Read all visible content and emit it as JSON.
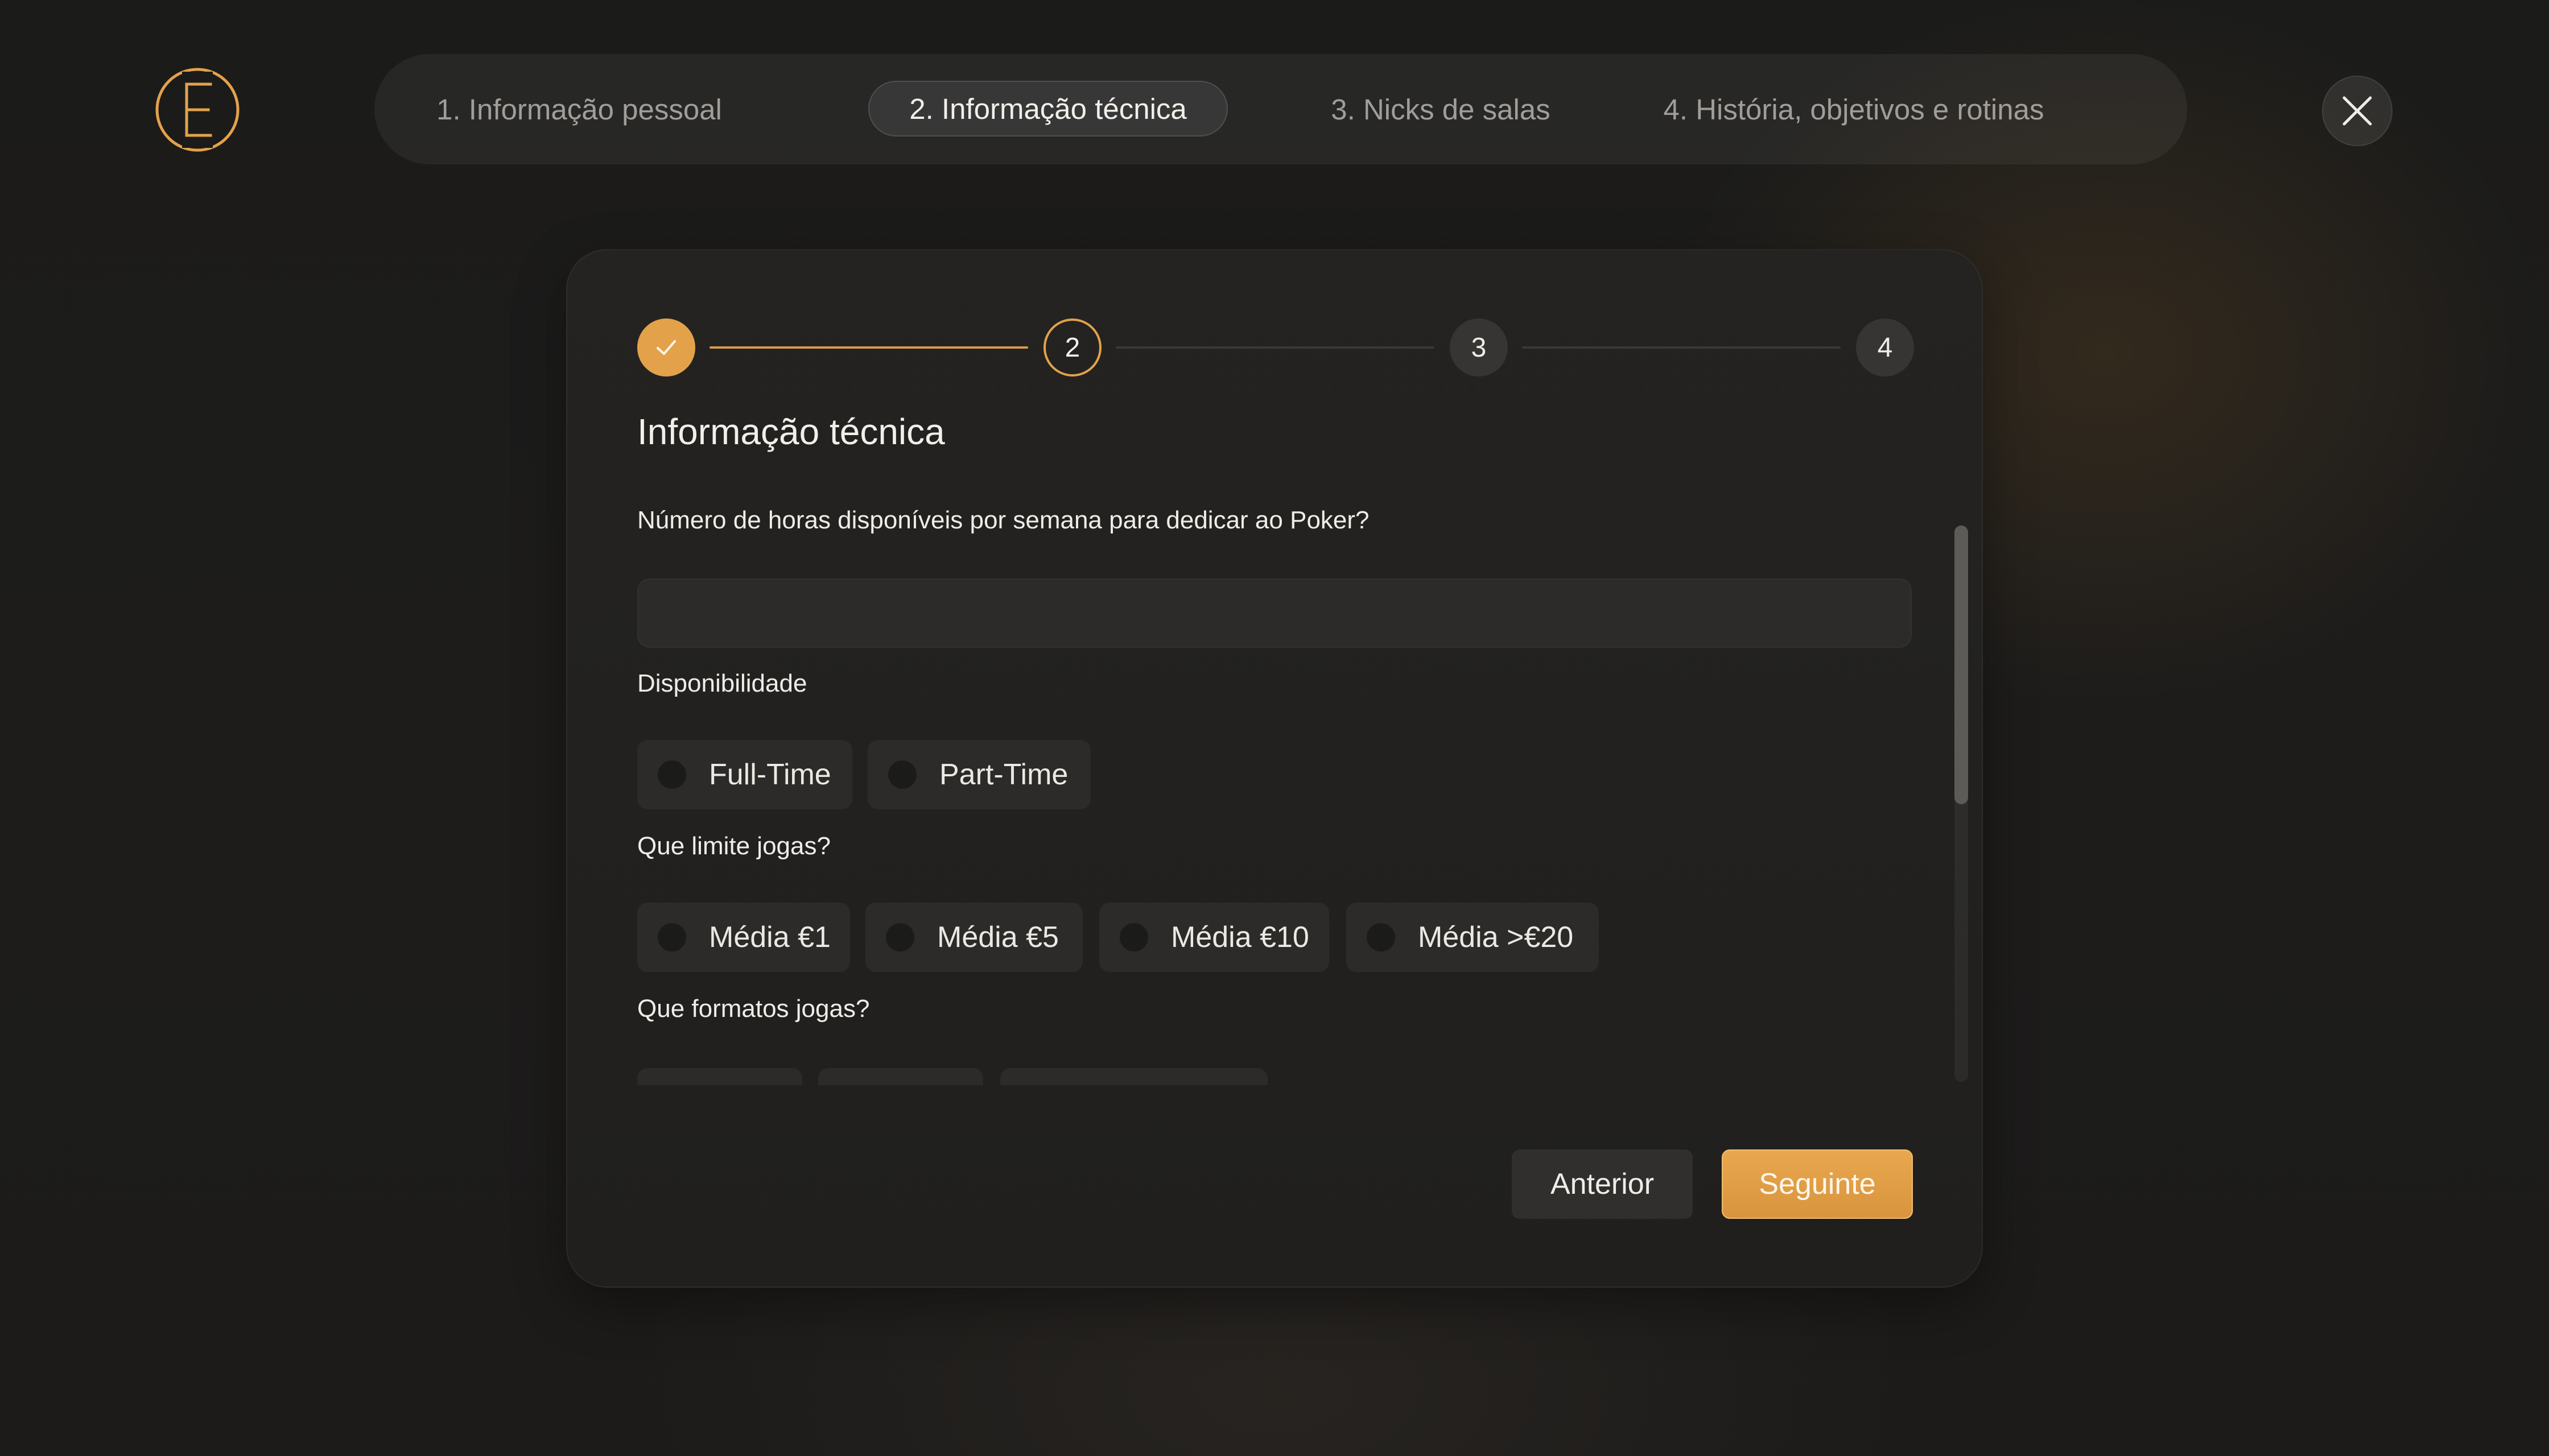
{
  "header": {
    "logo_icon": "e-monogram-logo-icon",
    "steps": [
      {
        "label": "1. Informação pessoal",
        "active": false
      },
      {
        "label": "2. Informação técnica",
        "active": true
      },
      {
        "label": "3. Nicks de salas",
        "active": false
      },
      {
        "label": "4. História, objetivos e rotinas",
        "active": false
      }
    ],
    "close_icon": "close-icon"
  },
  "progress": {
    "steps": [
      {
        "number": "1",
        "state": "done",
        "icon": "check-icon"
      },
      {
        "number": "2",
        "state": "current"
      },
      {
        "number": "3",
        "state": "todo"
      },
      {
        "number": "4",
        "state": "todo"
      }
    ],
    "accent_color": "#E3A24A"
  },
  "form": {
    "title": "Informação técnica",
    "hours_question": "Número de horas disponíveis por semana para dedicar ao Poker?",
    "hours_value": "",
    "availability": {
      "label": "Disponibilidade",
      "options": [
        "Full-Time",
        "Part-Time"
      ]
    },
    "limit": {
      "label": "Que limite jogas?",
      "options": [
        "Média €1",
        "Média €5",
        "Média €10",
        "Média >€20"
      ]
    },
    "formats": {
      "label": "Que formatos jogas?"
    }
  },
  "footer": {
    "previous_label": "Anterior",
    "next_label": "Seguinte"
  }
}
